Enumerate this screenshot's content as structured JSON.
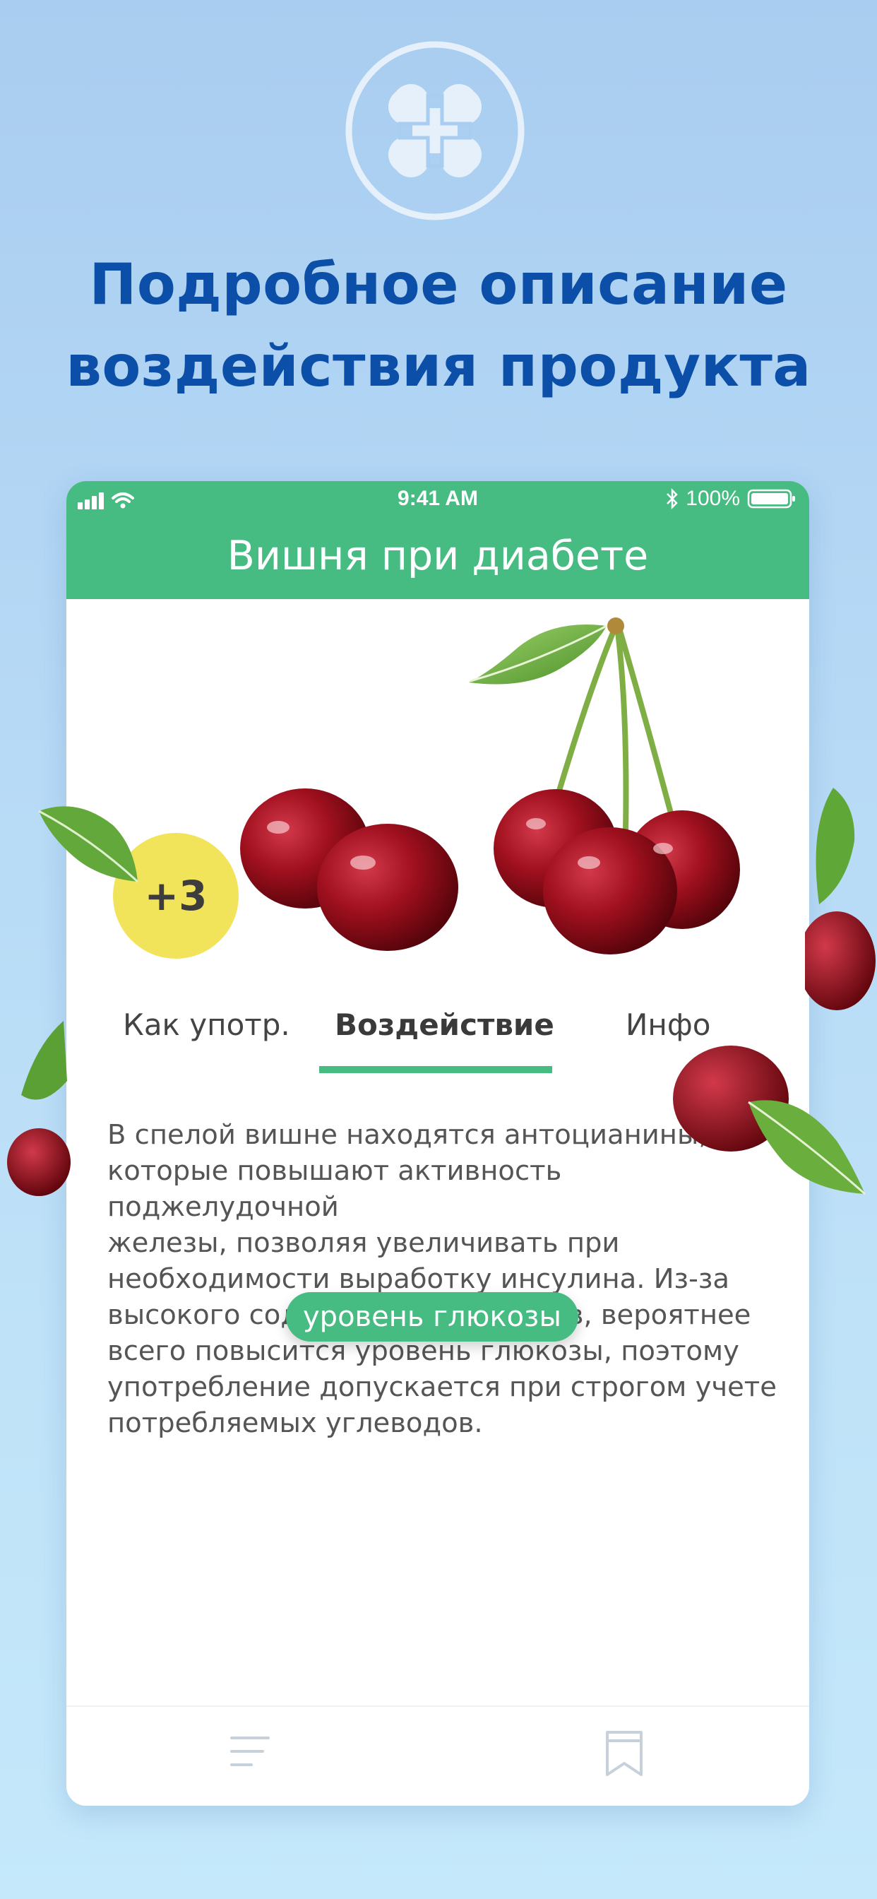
{
  "headline": {
    "line1": "Подробное описание",
    "line2": "воздействия продукта"
  },
  "logo": {
    "icon": "clover-cross-icon"
  },
  "status_bar": {
    "time": "9:41 AM",
    "battery": "100%",
    "icons": [
      "signal-icon",
      "wifi-icon",
      "bluetooth-icon",
      "battery-icon"
    ]
  },
  "screen": {
    "title": "Вишня при диабете",
    "image": "cherries-image",
    "badge": "+3",
    "tabs": [
      {
        "label": "Как употр.",
        "active": false
      },
      {
        "label": "Воздействие",
        "active": true
      },
      {
        "label": "Инфо",
        "active": false
      }
    ],
    "description_lines": [
      "В спелой вишне находятся антоцианины,",
      "которые повышают активность поджелудочной",
      "железы, позволяя увеличивать при",
      "необходимости выработку инсулина. Из-за",
      "высокого содержания углеводов, вероятнее",
      "всего повысится уровень глюкозы, поэтому",
      "употребление допускается при строгом учете",
      "потребляемых углеводов."
    ],
    "bottom_bar": {
      "icons": [
        "menu-icon",
        "bookmark-icon"
      ]
    }
  },
  "tooltip": {
    "label": "уровень глюкозы"
  },
  "colors": {
    "accent": "#46bb82",
    "headline": "#0c4fa8",
    "badge": "#f2e45a",
    "background": "#b7daf6"
  }
}
